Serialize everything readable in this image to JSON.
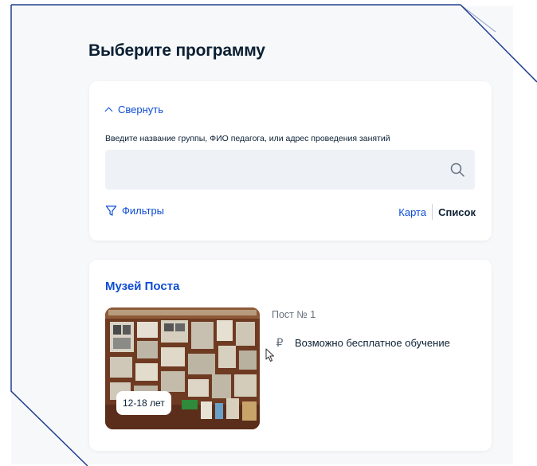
{
  "page": {
    "title": "Выберите программу"
  },
  "search": {
    "collapse_label": "Свернуть",
    "field_label": "Введите название группы, ФИО педагога, или адрес проведения занятий",
    "value": "",
    "placeholder": "",
    "icon": "search-icon"
  },
  "controls": {
    "filters_label": "Фильтры",
    "map_label": "Карта",
    "list_label": "Список",
    "active_view": "list"
  },
  "results": [
    {
      "title": "Музей Поста",
      "organization": "Пост № 1",
      "age": "12-18 лет",
      "price": "Возможно бесплатное обучение",
      "price_icon": "ruble-icon"
    }
  ],
  "colors": {
    "accent": "#0d4cd3",
    "text": "#0b1f33",
    "muted": "#66727f",
    "page_bg": "#f7f8fa",
    "input_bg": "#eef2f7",
    "frame_line": "#1f3f8f"
  }
}
